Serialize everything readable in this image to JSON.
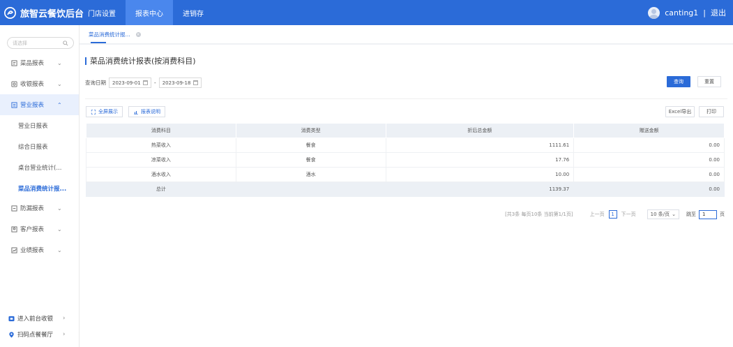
{
  "header": {
    "brand": "旅智云餐饮后台",
    "nav": [
      "门店设置",
      "报表中心",
      "进销存"
    ],
    "active_nav": 1,
    "username": "canting1",
    "separator": "|",
    "logout": "退出",
    "brand_color": "#2b6bd8"
  },
  "sidebar": {
    "search_placeholder": "请选择",
    "menus": [
      {
        "label": "菜品报表",
        "icon": "dish-report-icon"
      },
      {
        "label": "收银报表",
        "icon": "cashier-report-icon"
      },
      {
        "label": "营业报表",
        "icon": "business-report-icon",
        "open": true
      },
      {
        "label": "防漏报表",
        "icon": "leak-report-icon"
      },
      {
        "label": "客户报表",
        "icon": "customer-report-icon"
      },
      {
        "label": "业绩报表",
        "icon": "performance-report-icon"
      }
    ],
    "submenu": [
      "营业日报表",
      "综合日报表",
      "桌台营业统计(...",
      "菜品消费统计报..."
    ],
    "active_submenu": 3,
    "bottom": [
      {
        "label": "进入前台收银",
        "icon": "cashier-entry-icon"
      },
      {
        "label": "扫码点餐餐厅",
        "icon": "location-pin-icon"
      }
    ]
  },
  "tabs": [
    {
      "label": "菜品消费统计报..."
    }
  ],
  "page": {
    "title": "菜品消费统计报表(按消费科目)",
    "date_label": "查询日期",
    "date_start": "2023-09-01",
    "date_end": "2023-09-18",
    "date_separator": "-",
    "query_button": "查询",
    "reset_button": "重置",
    "fullscreen_button": "全屏展示",
    "report_info_button": "报表说明",
    "excel_button": "Excel导出",
    "print_button": "打印"
  },
  "table": {
    "columns": [
      "消费科目",
      "消费类型",
      "折后总金额",
      "赠送金额"
    ],
    "rows": [
      [
        "热菜收入",
        "餐食",
        "1111.61",
        "0.00"
      ],
      [
        "凉菜收入",
        "餐食",
        "17.76",
        "0.00"
      ],
      [
        "酒水收入",
        "酒水",
        "10.00",
        "0.00"
      ]
    ],
    "total": [
      "总计",
      "",
      "1139.37",
      "0.00"
    ]
  },
  "pagination": {
    "info": "[共3条 每页10条 当前第1/1页]",
    "prev": "上一页",
    "current": "1",
    "next": "下一页",
    "page_size": "10 条/页",
    "jump_label": "跳至",
    "jump_value": "1",
    "unit": "页"
  }
}
